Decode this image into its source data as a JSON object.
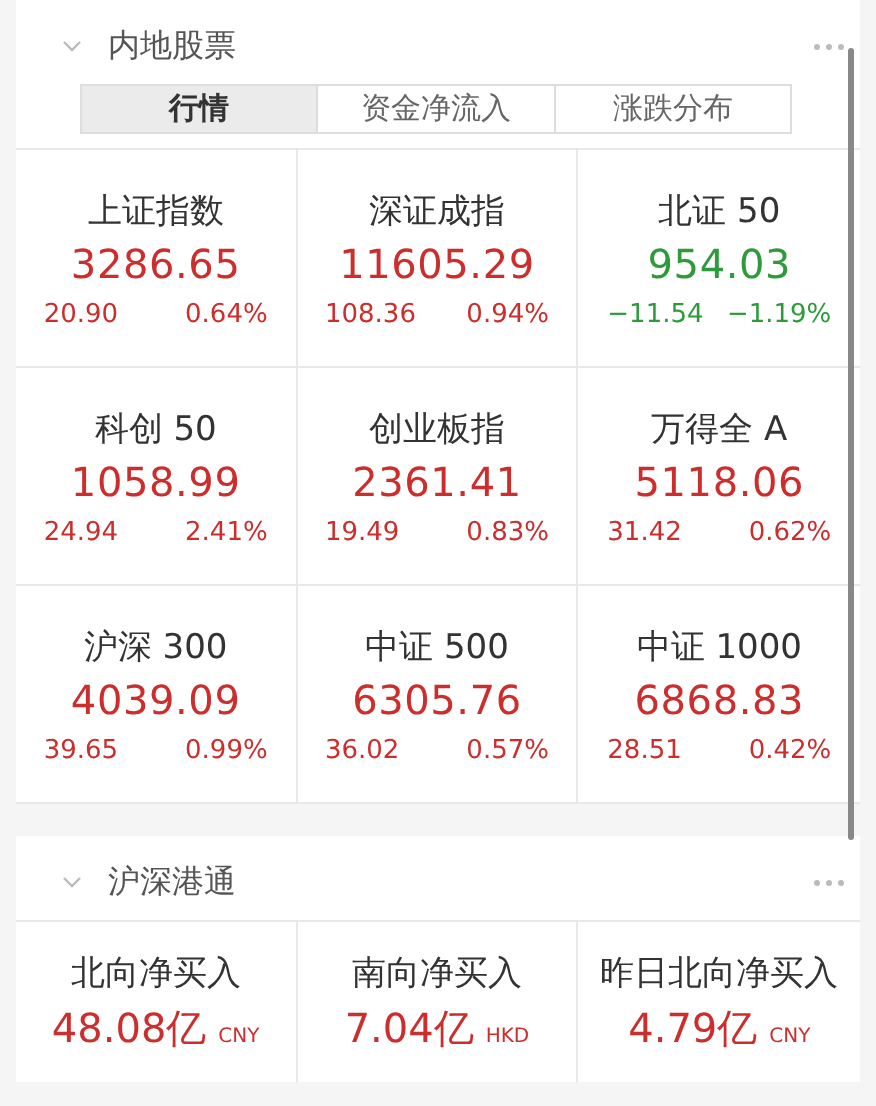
{
  "sections": [
    {
      "title": "内地股票",
      "expanded": true,
      "tabs": [
        {
          "label": "行情",
          "selected": true
        },
        {
          "label": "资金净流入",
          "selected": false
        },
        {
          "label": "涨跌分布",
          "selected": false
        }
      ],
      "indices": [
        {
          "name": "上证指数",
          "value": "3286.65",
          "change": "20.90",
          "percent": "0.64%",
          "color": "#cc2d2d"
        },
        {
          "name": "深证成指",
          "value": "11605.29",
          "change": "108.36",
          "percent": "0.94%",
          "color": "#cc2d2d"
        },
        {
          "name": "北证 50",
          "value": "954.03",
          "change": "−11.54",
          "percent": "−1.19%",
          "color": "#2e9a3c"
        },
        {
          "name": "科创 50",
          "value": "1058.99",
          "change": "24.94",
          "percent": "2.41%",
          "color": "#cc2d2d"
        },
        {
          "name": "创业板指",
          "value": "2361.41",
          "change": "19.49",
          "percent": "0.83%",
          "color": "#cc2d2d"
        },
        {
          "name": "万得全 A",
          "value": "5118.06",
          "change": "31.42",
          "percent": "0.62%",
          "color": "#cc2d2d"
        },
        {
          "name": "沪深 300",
          "value": "4039.09",
          "change": "39.65",
          "percent": "0.99%",
          "color": "#cc2d2d"
        },
        {
          "name": "中证 500",
          "value": "6305.76",
          "change": "36.02",
          "percent": "0.57%",
          "color": "#cc2d2d"
        },
        {
          "name": "中证 1000",
          "value": "6868.83",
          "change": "28.51",
          "percent": "0.42%",
          "color": "#cc2d2d"
        }
      ]
    },
    {
      "title": "沪深港通",
      "expanded": true,
      "flows": [
        {
          "name": "北向净买入",
          "amount": "48.08亿",
          "currency": "CNY"
        },
        {
          "name": "南向净买入",
          "amount": "7.04亿",
          "currency": "HKD"
        },
        {
          "name": "昨日北向净买入",
          "amount": "4.79亿",
          "currency": "CNY"
        }
      ]
    }
  ]
}
